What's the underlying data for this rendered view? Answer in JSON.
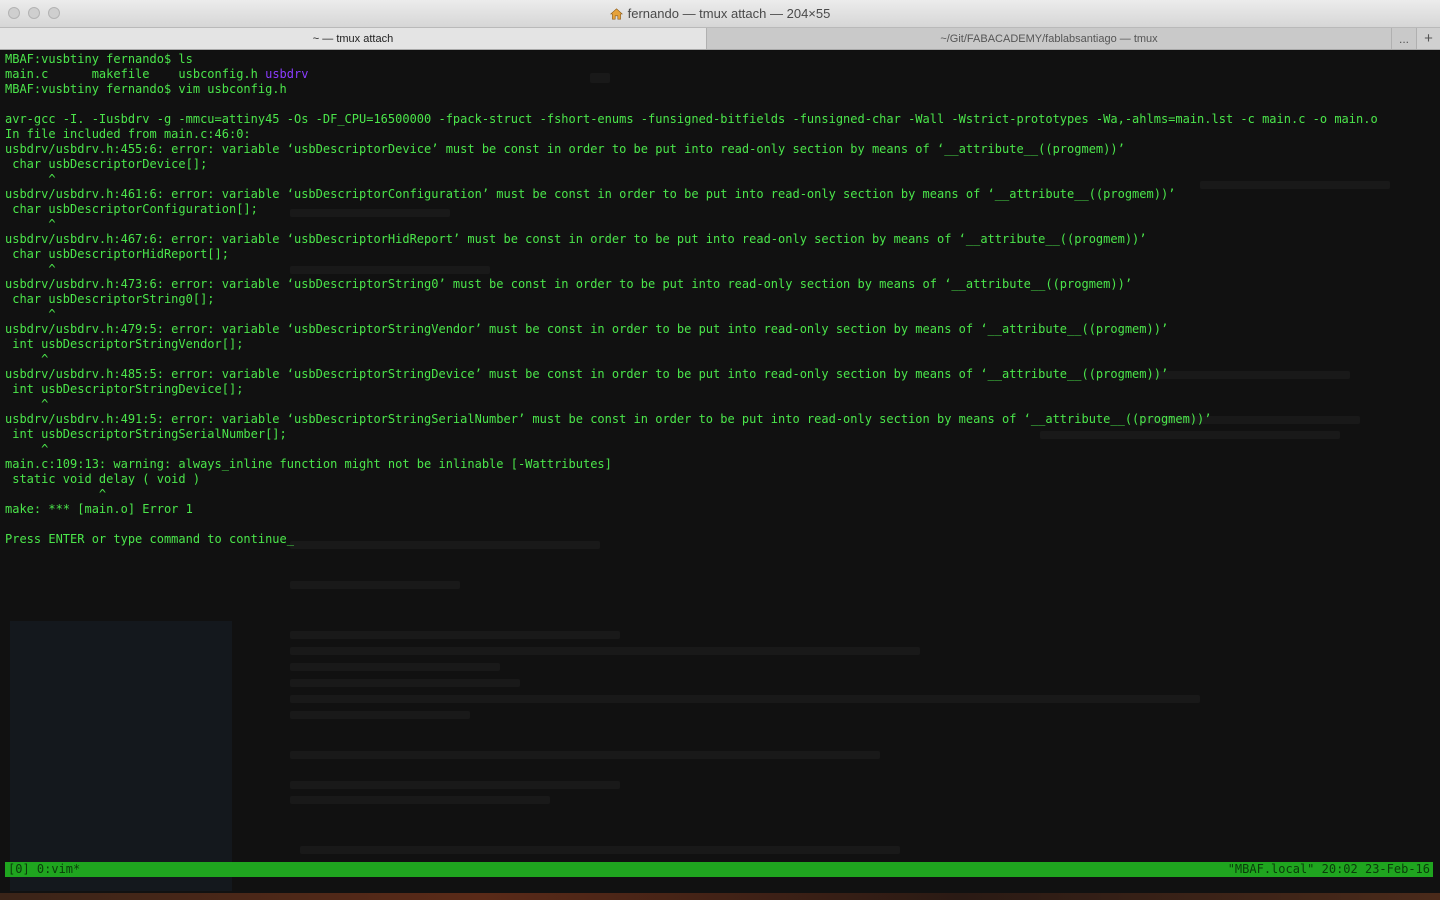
{
  "window": {
    "title": "fernando — tmux attach — 204×55"
  },
  "tabs": [
    {
      "label": "~ — tmux attach",
      "active": true
    },
    {
      "label": "~/Git/FABACADEMY/fablabsantiago — tmux",
      "active": false
    }
  ],
  "tab_more_label": "...",
  "tab_add_label": "+",
  "terminal": {
    "lines": [
      "MBAF:vusbtiny fernando$ ls",
      "main.c      makefile    usbconfig.h ",
      "MBAF:vusbtiny fernando$ vim usbconfig.h",
      "",
      "avr-gcc -I. -Iusbdrv -g -mmcu=attiny45 -Os -DF_CPU=16500000 -fpack-struct -fshort-enums -funsigned-bitfields -funsigned-char -Wall -Wstrict-prototypes -Wa,-ahlms=main.lst -c main.c -o main.o",
      "In file included from main.c:46:0:",
      "usbdrv/usbdrv.h:455:6: error: variable ‘usbDescriptorDevice’ must be const in order to be put into read-only section by means of ‘__attribute__((progmem))’",
      " char usbDescriptorDevice[];",
      "      ^",
      "usbdrv/usbdrv.h:461:6: error: variable ‘usbDescriptorConfiguration’ must be const in order to be put into read-only section by means of ‘__attribute__((progmem))’",
      " char usbDescriptorConfiguration[];",
      "      ^",
      "usbdrv/usbdrv.h:467:6: error: variable ‘usbDescriptorHidReport’ must be const in order to be put into read-only section by means of ‘__attribute__((progmem))’",
      " char usbDescriptorHidReport[];",
      "      ^",
      "usbdrv/usbdrv.h:473:6: error: variable ‘usbDescriptorString0’ must be const in order to be put into read-only section by means of ‘__attribute__((progmem))’",
      " char usbDescriptorString0[];",
      "      ^",
      "usbdrv/usbdrv.h:479:5: error: variable ‘usbDescriptorStringVendor’ must be const in order to be put into read-only section by means of ‘__attribute__((progmem))’",
      " int usbDescriptorStringVendor[];",
      "     ^",
      "usbdrv/usbdrv.h:485:5: error: variable ‘usbDescriptorStringDevice’ must be const in order to be put into read-only section by means of ‘__attribute__((progmem))’",
      " int usbDescriptorStringDevice[];",
      "     ^",
      "usbdrv/usbdrv.h:491:5: error: variable ‘usbDescriptorStringSerialNumber’ must be const in order to be put into read-only section by means of ‘__attribute__((progmem))’",
      " int usbDescriptorStringSerialNumber[];",
      "     ^",
      "main.c:109:13: warning: always_inline function might not be inlinable [-Wattributes]",
      " static void delay ( void )",
      "             ^",
      "make: *** [main.o] Error 1",
      "",
      "Press ENTER or type command to continue_"
    ],
    "ls_dir_entry": "usbdrv"
  },
  "statusbar": {
    "left": "[0] 0:vim*",
    "right": "\"MBAF.local\" 20:02 23-Feb-16"
  },
  "colors": {
    "terminal_text": "#4be64b",
    "directory": "#8a3cff",
    "statusbar_bg": "#1fa51f",
    "terminal_bg": "#111111"
  }
}
